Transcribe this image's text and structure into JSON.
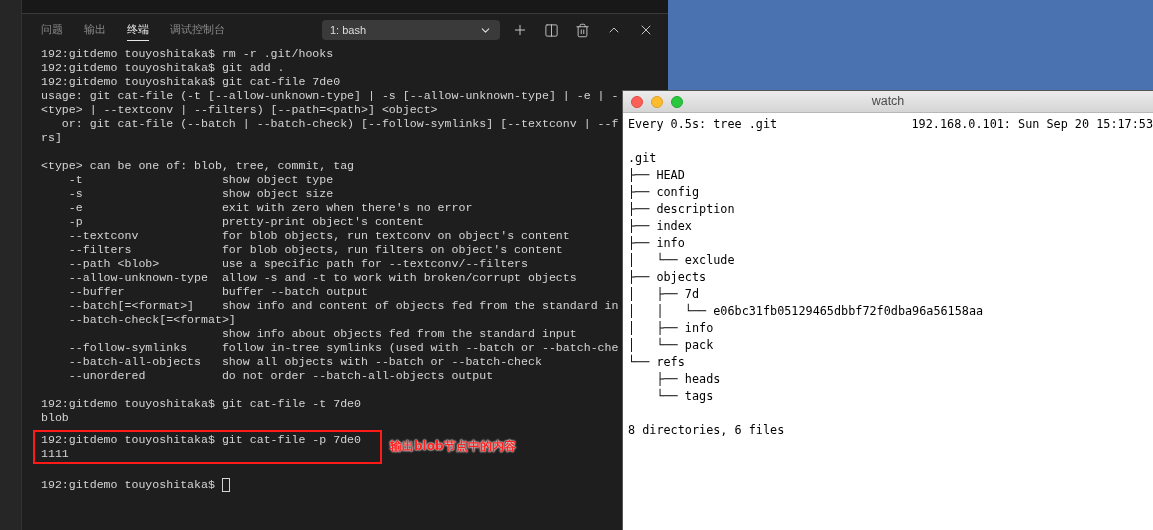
{
  "panel": {
    "tabs": [
      {
        "label": "问题",
        "selected": false
      },
      {
        "label": "输出",
        "selected": false
      },
      {
        "label": "终端",
        "selected": true
      },
      {
        "label": "调试控制台",
        "selected": false
      }
    ],
    "terminal_select": {
      "value": "1: bash"
    }
  },
  "terminal": {
    "blocks": [
      {
        "kind": "plain",
        "lines": [
          "192:gitdemo touyoshitaka$ rm -r .git/hooks",
          "192:gitdemo touyoshitaka$ git add .",
          "192:gitdemo touyoshitaka$ git cat-file 7de0",
          "usage: git cat-file (-t [--allow-unknown-type] | -s [--allow-unknown-type] | -e | -",
          "<type> | --textconv | --filters) [--path=<path>] <object>",
          "   or: git cat-file (--batch | --batch-check) [--follow-symlinks] [--textconv | --f",
          "rs]"
        ]
      },
      {
        "kind": "plain",
        "lines": [
          "<type> can be one of: blob, tree, commit, tag",
          "    -t                    show object type",
          "    -s                    show object size",
          "    -e                    exit with zero when there's no error",
          "    -p                    pretty-print object's content",
          "    --textconv            for blob objects, run textconv on object's content",
          "    --filters             for blob objects, run filters on object's content",
          "    --path <blob>         use a specific path for --textconv/--filters",
          "    --allow-unknown-type  allow -s and -t to work with broken/corrupt objects",
          "    --buffer              buffer --batch output",
          "    --batch[=<format>]    show info and content of objects fed from the standard in",
          "    --batch-check[=<format>]",
          "                          show info about objects fed from the standard input",
          "    --follow-symlinks     follow in-tree symlinks (used with --batch or --batch-che",
          "    --batch-all-objects   show all objects with --batch or --batch-check",
          "    --unordered           do not order --batch-all-objects output"
        ]
      },
      {
        "kind": "plain",
        "lines": [
          "192:gitdemo touyoshitaka$ git cat-file -t 7de0",
          "blob"
        ]
      },
      {
        "kind": "highlighted",
        "lines": [
          "192:gitdemo touyoshitaka$ git cat-file -p 7de0",
          "1111"
        ],
        "note": "输出blob节点中的内容"
      },
      {
        "kind": "prompt",
        "lines": [
          "192:gitdemo touyoshitaka$ "
        ]
      }
    ]
  },
  "watch_window": {
    "title": "watch",
    "command": "Every 0.5s: tree .git",
    "host_time": "192.168.0.101: Sun Sep 20 15:17:53",
    "tree": [
      ".git",
      "├── HEAD",
      "├── config",
      "├── description",
      "├── index",
      "├── info",
      "│   └── exclude",
      "├── objects",
      "│   ├── 7d",
      "│   │   └── e06bc31fb05129465dbbf72f0dba96a56158aa",
      "│   ├── info",
      "│   └── pack",
      "└── refs",
      "    ├── heads",
      "    └── tags"
    ],
    "summary": "8 directories, 6 files"
  }
}
